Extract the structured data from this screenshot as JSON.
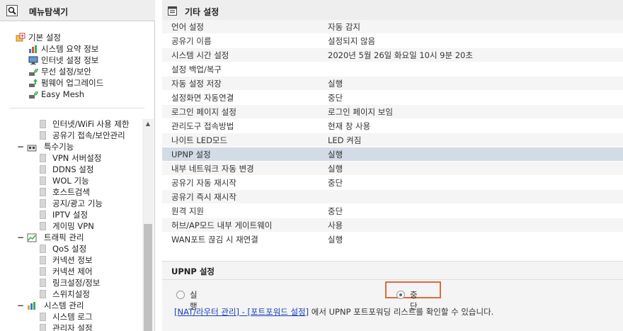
{
  "left_panel": {
    "title": "메뉴탐색기",
    "top_tree": [
      {
        "label": "기본 설정",
        "icon": "folder-basic-icon"
      },
      {
        "label": "시스템 요약 정보",
        "icon": "chart-icon"
      },
      {
        "label": "인터넷 설정 정보",
        "icon": "monitor-icon"
      },
      {
        "label": "무선 설정/보안",
        "icon": "wireless-icon"
      },
      {
        "label": "펌웨어 업그레이드",
        "icon": "upgrade-icon"
      },
      {
        "label": "Easy Mesh",
        "icon": "mesh-icon"
      }
    ],
    "lower_tree": [
      {
        "label": "인터넷/WiFi 사용 제한",
        "kind": "leaf"
      },
      {
        "label": "공유기 접속/보안관리",
        "kind": "leaf"
      },
      {
        "label": "특수기능",
        "kind": "group",
        "icon": "special-icon"
      },
      {
        "label": "VPN 서버설정",
        "kind": "leaf"
      },
      {
        "label": "DDNS 설정",
        "kind": "leaf"
      },
      {
        "label": "WOL 기능",
        "kind": "leaf"
      },
      {
        "label": "호스트검색",
        "kind": "leaf"
      },
      {
        "label": "공지/광고 기능",
        "kind": "leaf"
      },
      {
        "label": "IPTV 설정",
        "kind": "leaf"
      },
      {
        "label": "게이밍 VPN",
        "kind": "leaf"
      },
      {
        "label": "트래픽 관리",
        "kind": "group",
        "icon": "traffic-icon"
      },
      {
        "label": "QoS 설정",
        "kind": "leaf"
      },
      {
        "label": "커넥션 정보",
        "kind": "leaf"
      },
      {
        "label": "커넥션 제어",
        "kind": "leaf"
      },
      {
        "label": "링크설정/정보",
        "kind": "leaf"
      },
      {
        "label": "스위치설정",
        "kind": "leaf"
      },
      {
        "label": "시스템 관리",
        "kind": "group",
        "icon": "system-icon"
      },
      {
        "label": "시스템 로그",
        "kind": "leaf"
      },
      {
        "label": "관리자 설정",
        "kind": "leaf"
      }
    ]
  },
  "right_panel": {
    "title": "기타 설정",
    "rows": [
      {
        "key": "언어 설정",
        "value": "자동 감지"
      },
      {
        "key": "공유기 이름",
        "value": "설정되지 않음"
      },
      {
        "key": "시스템 시간 설정",
        "value": "2020년 5월 26일 화요일 10시 9분 20초"
      },
      {
        "key": "설정 백업/복구",
        "value": ""
      },
      {
        "key": "자동 설정 저장",
        "value": "실행"
      },
      {
        "key": "설정화면 자동연결",
        "value": "중단"
      },
      {
        "key": "로그인 페이지 설정",
        "value": "로그인 페이지 보임"
      },
      {
        "key": "관리도구 접속방법",
        "value": "현재 창 사용"
      },
      {
        "key": "나이트 LED모드",
        "value": "LED 켜짐"
      },
      {
        "key": "UPNP 설정",
        "value": "실행"
      },
      {
        "key": "내부 네트워크 자동 변경",
        "value": "실행"
      },
      {
        "key": "공유기 자동 재시작",
        "value": "중단"
      },
      {
        "key": "공유기 즉시 재시작",
        "value": ""
      },
      {
        "key": "원격 지원",
        "value": "중단"
      },
      {
        "key": "허브/AP모드 내부 게이트웨이",
        "value": "사용"
      },
      {
        "key": "WAN포트 끊김 시 재연결",
        "value": "실행"
      }
    ],
    "selected_row": "UPNP 설정",
    "detail": {
      "title": "UPNP 설정",
      "options": [
        {
          "label": "실행",
          "selected": false
        },
        {
          "label": "중단",
          "selected": true
        }
      ],
      "link_text": "[NAT/라우터 관리] - [포트포워드 설정]",
      "info_text": " 에서 UPNP 포트포워딩 리스트를 확인할 수 있습니다."
    }
  },
  "colors": {
    "selected_row": "#d2dbe6",
    "highlight_border": "#e06a3f",
    "link": "#1a3fb8"
  }
}
